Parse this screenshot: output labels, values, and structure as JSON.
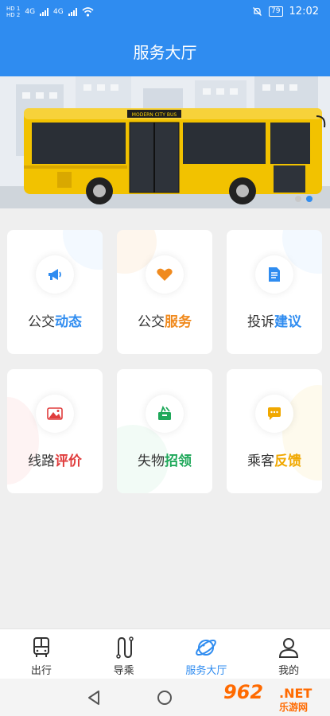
{
  "status_bar": {
    "hd1": "HD 1",
    "hd2": "HD 2",
    "net1": "4G",
    "net2": "4G",
    "battery": "79",
    "time": "12:02"
  },
  "header": {
    "title": "服务大厅"
  },
  "banner": {
    "bus_sign": "MODERN CITY BUS",
    "slides": 2,
    "active_slide": 2
  },
  "services": [
    {
      "prefix": "公交",
      "highlight": "动态",
      "color": "#2f8cf0",
      "icon": "megaphone-icon",
      "blob": "#dceeff"
    },
    {
      "prefix": "公交",
      "highlight": "服务",
      "color": "#f08a1e",
      "icon": "heart-icon",
      "blob": "#fde4cc"
    },
    {
      "prefix": "投诉",
      "highlight": "建议",
      "color": "#2f8cf0",
      "icon": "document-icon",
      "blob": "#dceeff"
    },
    {
      "prefix": "线路",
      "highlight": "评价",
      "color": "#e03c3c",
      "icon": "mountain-photo-icon",
      "blob": "#fbdede"
    },
    {
      "prefix": "失物",
      "highlight": "招领",
      "color": "#1fa85a",
      "icon": "lost-found-box-icon",
      "blob": "#d9f3e4"
    },
    {
      "prefix": "乘客",
      "highlight": "反馈",
      "color": "#f0a800",
      "icon": "chat-bubble-icon",
      "blob": "#fdf0cc"
    }
  ],
  "tabs": [
    {
      "label": "出行",
      "icon": "bus-icon",
      "active": false
    },
    {
      "label": "导乘",
      "icon": "route-icon",
      "active": false
    },
    {
      "label": "服务大厅",
      "icon": "planet-icon",
      "active": true
    },
    {
      "label": "我的",
      "icon": "user-icon",
      "active": false
    }
  ],
  "watermark": {
    "brand": "962",
    "domain": ".NET",
    "subtitle": "乐游网"
  },
  "colors": {
    "primary": "#2f8cf0",
    "background": "#efefef"
  }
}
